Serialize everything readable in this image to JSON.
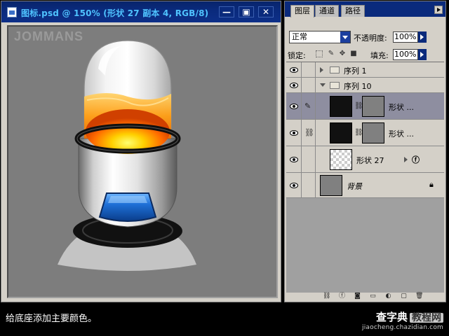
{
  "document": {
    "title": "图标.psd @ 150% (形状 27 副本 4, RGB/8)",
    "watermark": "JOMMANS",
    "buttons": {
      "minimize": "—",
      "maximize": "▣",
      "close": "✕"
    }
  },
  "layers_panel": {
    "tabs": [
      "图层",
      "通道",
      "路径"
    ],
    "active_tab": "图层",
    "blend_mode": "正常",
    "opacity_label": "不透明度:",
    "opacity_value": "100%",
    "lock_label": "锁定:",
    "fill_label": "填充:",
    "fill_value": "100%",
    "layers": [
      {
        "name": "序列 1",
        "kind": "group",
        "expanded": false
      },
      {
        "name": "序列 10",
        "kind": "group",
        "expanded": true
      },
      {
        "name": "形状 ...",
        "kind": "shape",
        "selected": true
      },
      {
        "name": "形状 ...",
        "kind": "shape",
        "selected": false
      },
      {
        "name": "形状 27",
        "kind": "shape",
        "selected": false
      },
      {
        "name": "背景",
        "kind": "background",
        "selected": false
      }
    ]
  },
  "caption": "给底座添加主要颜色。",
  "site": {
    "name": "查字典",
    "tag": "教程网",
    "url": "jiaocheng.chazidian.com"
  },
  "colors": {
    "title_bar": "#0a2a7c",
    "title_text": "#4fc3ff",
    "canvas_bg": "#7d7d7d",
    "selected_layer": "#8e8ea0",
    "orange_glow": "#ff9a00",
    "blue_button": "#1e6fd6"
  }
}
